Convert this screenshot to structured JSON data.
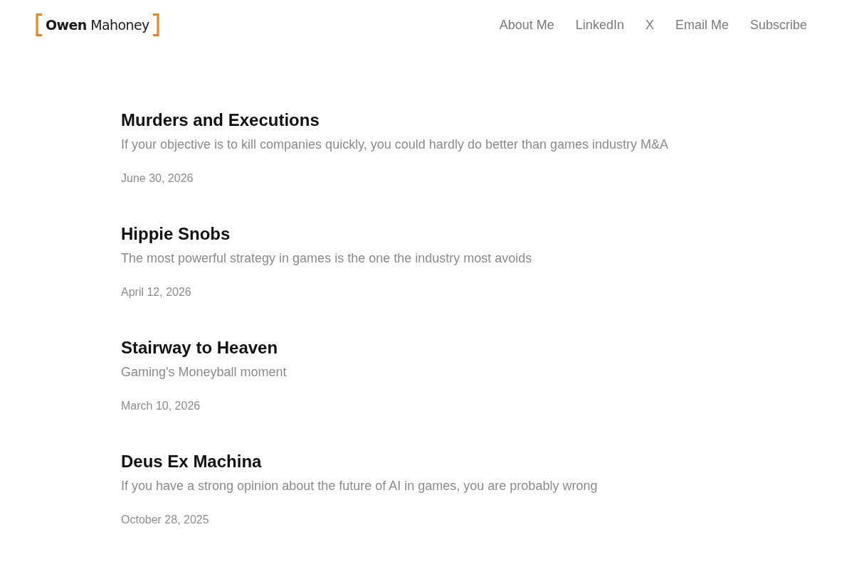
{
  "header": {
    "logo": "**Owen** Mahoney",
    "nav": [
      "About Me",
      "LinkedIn",
      "X",
      "Email Me",
      "Subscribe"
    ]
  },
  "posts": [
    {
      "title": "Murders and Executions",
      "subtitle": "If your objective is to kill companies quickly, you could hardly do better than games industry M&A",
      "date": "June 30, 2026"
    },
    {
      "title": "Hippie Snobs",
      "subtitle": "The most powerful strategy in games is the one the industry most avoids",
      "date": "April 12, 2026"
    },
    {
      "title": "Stairway to Heaven",
      "subtitle": "Gaming's Moneyball moment",
      "date": "March 10, 2026"
    },
    {
      "title": "Deus Ex Machina",
      "subtitle": "If you have a strong opinion about the future of AI in games, you are probably wrong",
      "date": "October 28, 2025"
    }
  ]
}
